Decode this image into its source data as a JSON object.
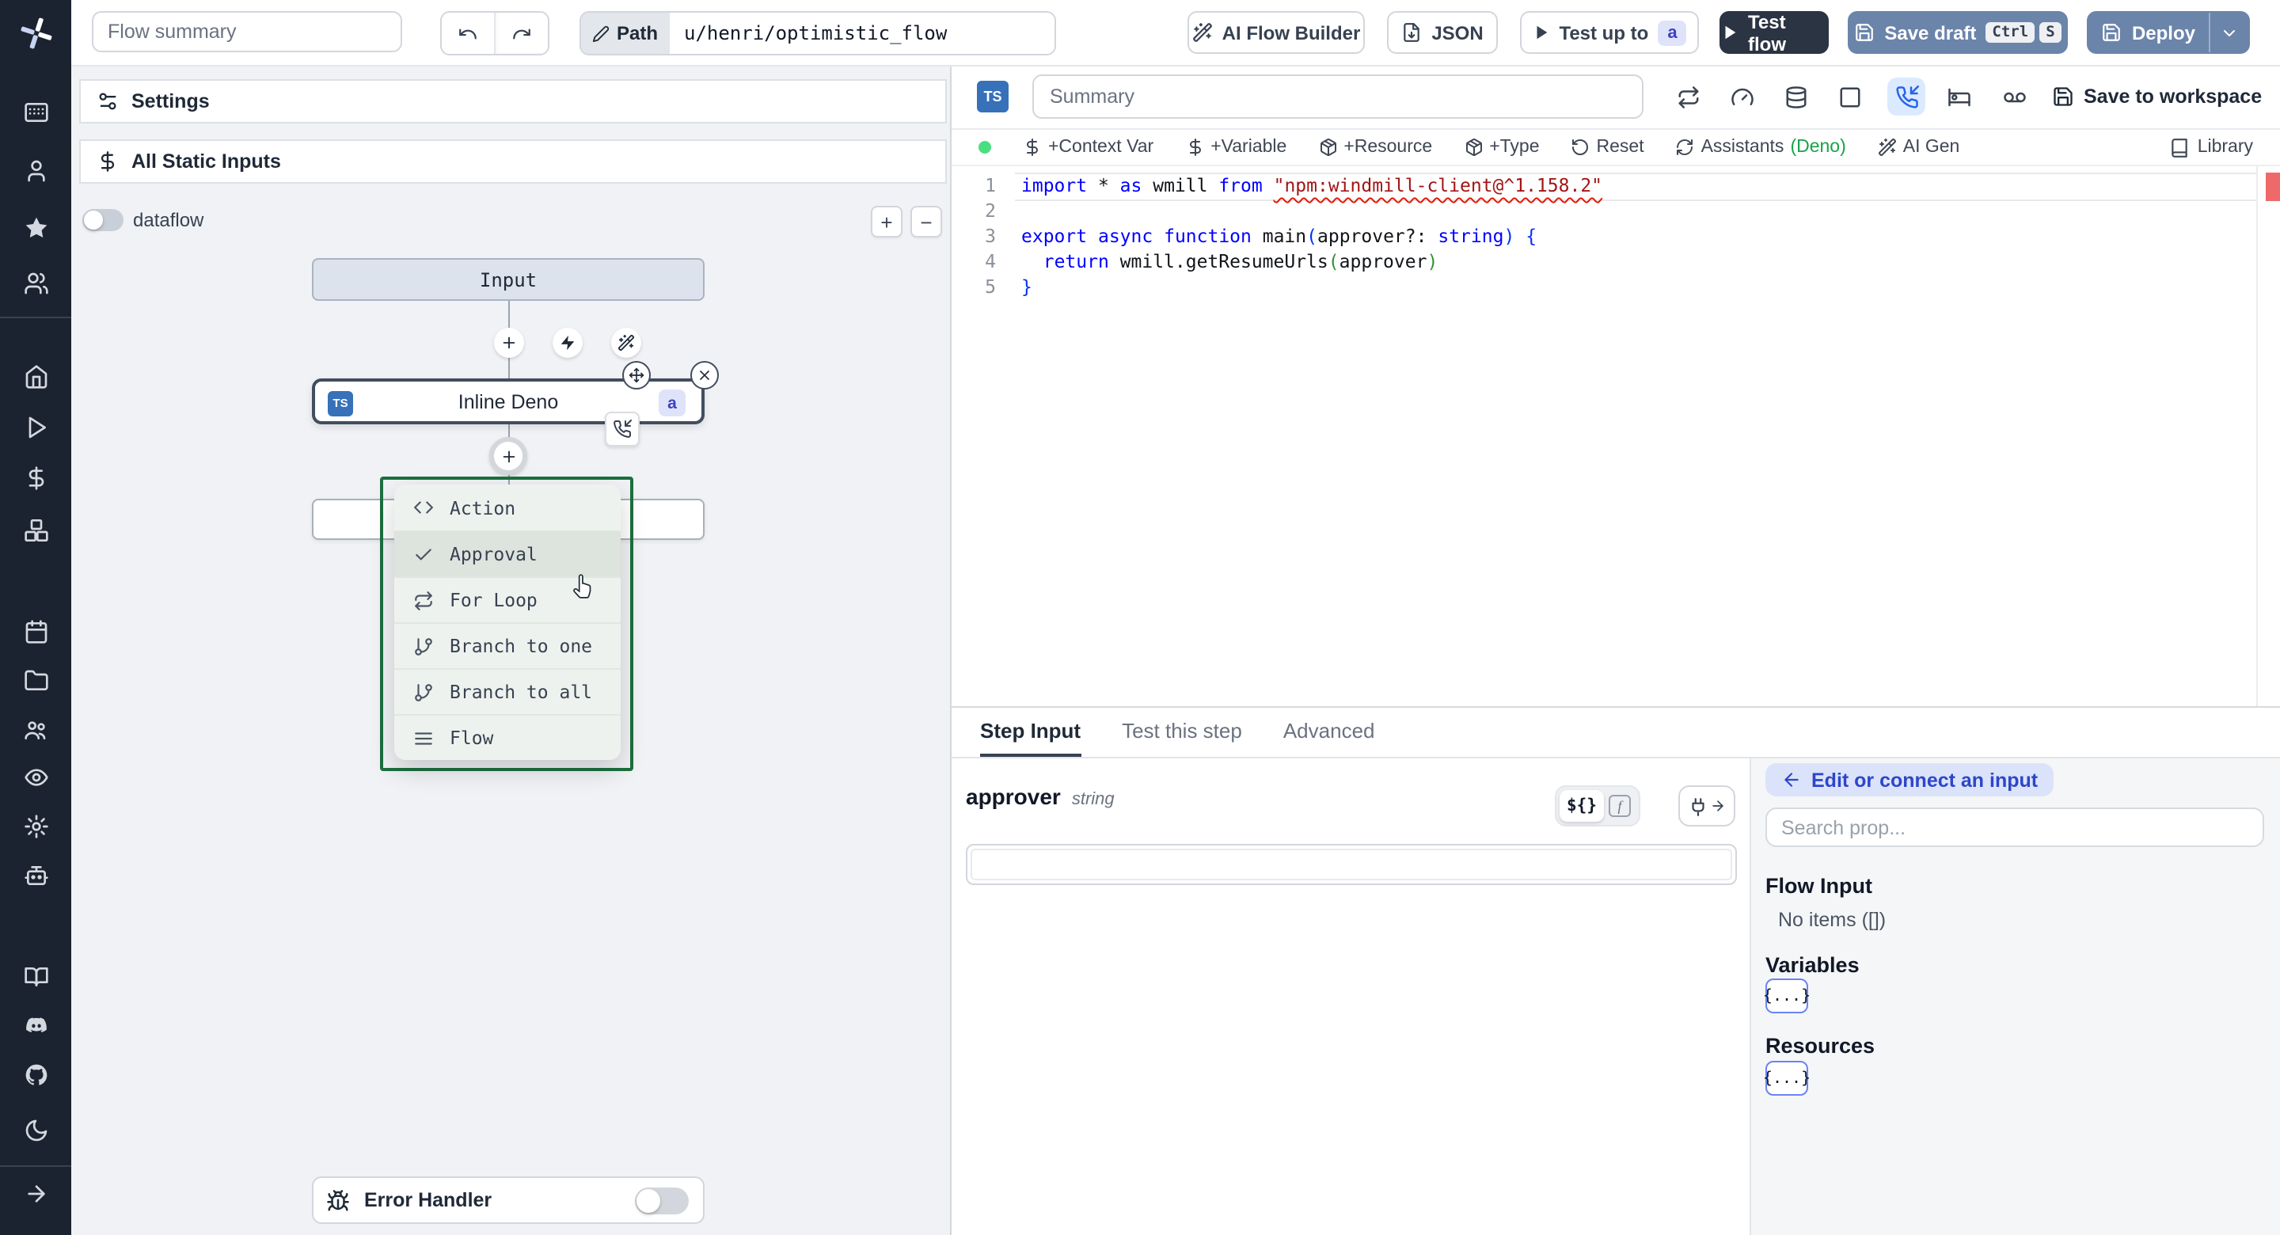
{
  "header": {
    "flow_summary_placeholder": "Flow summary",
    "path_label": "Path",
    "path_value": "u/henri/optimistic_flow",
    "ai_flow_builder": "AI Flow Builder",
    "json_label": "JSON",
    "test_up_to": "Test up to",
    "test_up_to_badge": "a",
    "test_flow": "Test flow",
    "save_draft": "Save draft",
    "save_draft_kbd": [
      "Ctrl",
      "S"
    ],
    "deploy": "Deploy"
  },
  "sidebar": {
    "items": [
      "app-window",
      "user",
      "star",
      "users",
      "home",
      "play",
      "dollar",
      "boxes",
      "calendar",
      "folder",
      "user-group",
      "eye",
      "gear",
      "bot",
      "book",
      "discord",
      "github",
      "moon"
    ],
    "expand_icon": "arrow-right"
  },
  "flow_panel": {
    "settings_label": "Settings",
    "static_inputs_label": "All Static Inputs",
    "dataflow_label": "dataflow",
    "zoom_in_label": "+",
    "zoom_out_label": "−",
    "input_node_label": "Input",
    "step_node": {
      "lang_badge": "TS",
      "title": "Inline Deno",
      "id_badge": "a"
    },
    "insert_menu": {
      "items": [
        {
          "icon": "code",
          "label": "Action",
          "active": false
        },
        {
          "icon": "check",
          "label": "Approval",
          "active": true
        },
        {
          "icon": "repeat",
          "label": "For Loop",
          "active": false
        },
        {
          "icon": "git-branch",
          "label": "Branch to one",
          "active": false
        },
        {
          "icon": "git-branch",
          "label": "Branch to all",
          "active": false
        },
        {
          "icon": "menu",
          "label": "Flow",
          "active": false
        }
      ]
    },
    "error_handler_label": "Error Handler"
  },
  "editor_panel": {
    "lang_badge": "TS",
    "summary_placeholder": "Summary",
    "toolbar_icons": [
      "repeat",
      "gauge",
      "database",
      "square",
      "phone-in",
      "bed",
      "voicemail"
    ],
    "highlighted_toolbar_icon": "phone-in",
    "save_to_workspace": "Save to workspace",
    "status_dot_color": "#4ade80",
    "actions": [
      {
        "icon": "dollar",
        "label": "+Context Var"
      },
      {
        "icon": "dollar",
        "label": "+Variable"
      },
      {
        "icon": "package",
        "label": "+Resource"
      },
      {
        "icon": "package",
        "label": "+Type"
      },
      {
        "icon": "rotate-ccw",
        "label": "Reset"
      },
      {
        "icon": "refresh",
        "label": "Assistants",
        "suffix": "(Deno)"
      },
      {
        "icon": "wand",
        "label": "AI Gen"
      }
    ],
    "library_label": "Library",
    "code": {
      "lines": [
        {
          "n": "1",
          "current": true,
          "tokens": [
            {
              "t": "import",
              "c": "kw"
            },
            {
              "t": " * ",
              "c": "pl"
            },
            {
              "t": "as",
              "c": "kw"
            },
            {
              "t": " wmill ",
              "c": "pl"
            },
            {
              "t": "from",
              "c": "kw"
            },
            {
              "t": " ",
              "c": "pl"
            },
            {
              "t": "\"npm:windmill-client@^1.158.2\"",
              "c": "str sq"
            }
          ]
        },
        {
          "n": "2",
          "current": false,
          "tokens": []
        },
        {
          "n": "3",
          "current": false,
          "tokens": [
            {
              "t": "export",
              "c": "kw"
            },
            {
              "t": " ",
              "c": "pl"
            },
            {
              "t": "async",
              "c": "kw"
            },
            {
              "t": " ",
              "c": "pl"
            },
            {
              "t": "function",
              "c": "kw"
            },
            {
              "t": " main",
              "c": "pl"
            },
            {
              "t": "(",
              "c": "b1"
            },
            {
              "t": "approver?: ",
              "c": "pl"
            },
            {
              "t": "string",
              "c": "kw"
            },
            {
              "t": ")",
              "c": "b1"
            },
            {
              "t": " ",
              "c": "pl"
            },
            {
              "t": "{",
              "c": "b1"
            }
          ]
        },
        {
          "n": "4",
          "current": false,
          "tokens": [
            {
              "t": "  ",
              "c": "pl"
            },
            {
              "t": "return",
              "c": "kw"
            },
            {
              "t": " wmill.getResumeUrls",
              "c": "pl"
            },
            {
              "t": "(",
              "c": "b2"
            },
            {
              "t": "approver",
              "c": "pl"
            },
            {
              "t": ")",
              "c": "b2"
            }
          ]
        },
        {
          "n": "5",
          "current": false,
          "tokens": [
            {
              "t": "}",
              "c": "b1"
            }
          ]
        }
      ]
    }
  },
  "tabs": [
    {
      "label": "Step Input",
      "active": true
    },
    {
      "label": "Test this step",
      "active": false
    },
    {
      "label": "Advanced",
      "active": false
    }
  ],
  "step_input": {
    "field_name": "approver",
    "field_type": "string",
    "expr_toggle_label": "${}",
    "value": ""
  },
  "connect_panel": {
    "edit_label": "Edit or connect an input",
    "search_placeholder": "Search prop...",
    "flow_input_title": "Flow Input",
    "flow_input_empty": "No items ([])",
    "variables_title": "Variables",
    "variables_button": "{...}",
    "resources_title": "Resources",
    "resources_button": "{...}"
  }
}
